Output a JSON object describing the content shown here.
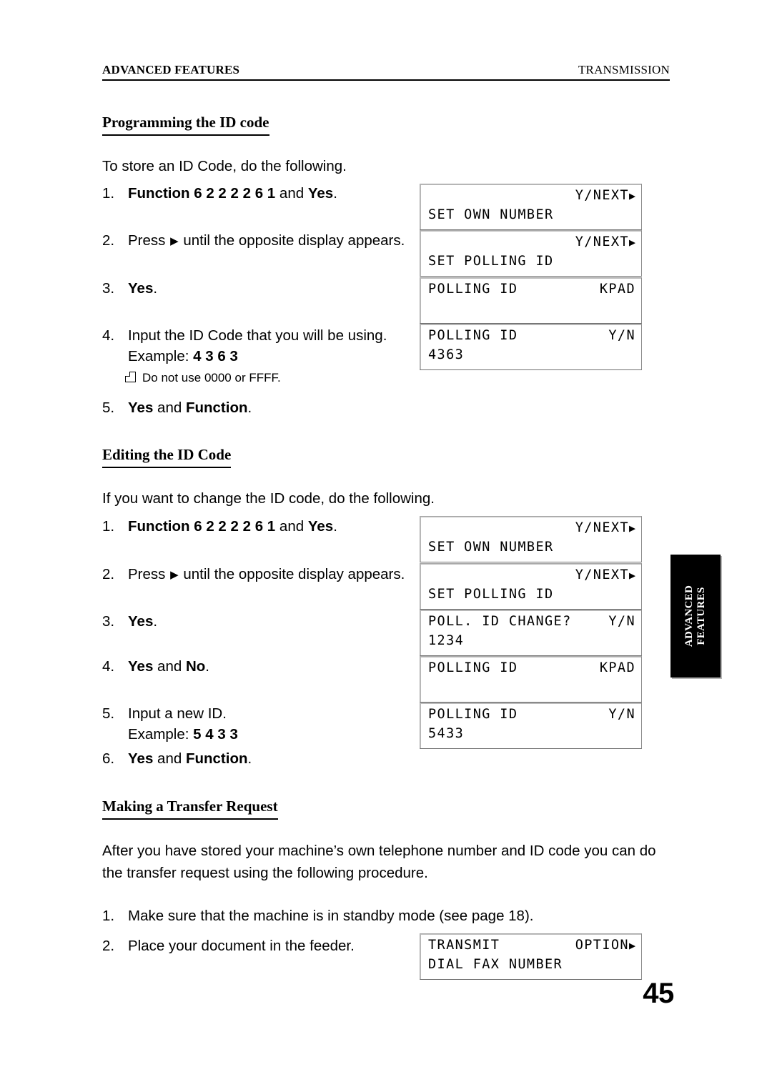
{
  "header": {
    "left": "ADVANCED FEATURES",
    "right": "TRANSMISSION"
  },
  "sections": {
    "programming": {
      "heading": "Programming the ID code",
      "intro": "To store an ID Code, do the following.",
      "steps": [
        {
          "num": "1.",
          "pre": "",
          "bold1": "Function 6 2 2 2 2 6 1",
          "mid": " and ",
          "bold2": "Yes",
          "post": "."
        },
        {
          "num": "2.",
          "pre": "Press ",
          "arrow": "▶",
          "post": " until the opposite display appears."
        },
        {
          "num": "3.",
          "bold1": "Yes",
          "post": "."
        },
        {
          "num": "4.",
          "line1": "Input the ID Code that you will be using.",
          "line2_pre": "Example: ",
          "line2_bold": "4 3 6 3"
        },
        {
          "num": "5.",
          "bold1": "Yes",
          "mid": " and ",
          "bold2": "Function",
          "post": "."
        }
      ],
      "note": "Do not use 0000 or FFFF.",
      "displays": [
        {
          "top_right": "Y/NEXT",
          "arrow": "▶",
          "bottom_left": "SET OWN NUMBER"
        },
        {
          "top_right": "Y/NEXT",
          "arrow": "▶",
          "bottom_left": "SET POLLING ID"
        },
        {
          "top_left": "POLLING ID",
          "top_right_plain": "KPAD",
          "bottom_left": ""
        },
        {
          "top_left": "POLLING ID",
          "top_right_plain": "Y/N",
          "bottom_left": "4363"
        }
      ]
    },
    "editing": {
      "heading": "Editing the ID Code",
      "intro": "If you want to change the ID code, do the following.",
      "steps": [
        {
          "num": "1.",
          "bold1": "Function 6 2 2 2 2 6 1",
          "mid": " and ",
          "bold2": "Yes",
          "post": "."
        },
        {
          "num": "2.",
          "pre": "Press ",
          "arrow": "▶",
          "post": " until the opposite display appears."
        },
        {
          "num": "3.",
          "bold1": "Yes",
          "post": "."
        },
        {
          "num": "4.",
          "bold1": "Yes",
          "mid": " and ",
          "bold2": "No",
          "post": "."
        },
        {
          "num": "5.",
          "line1": "Input a new ID.",
          "line2_pre": "Example: ",
          "line2_bold": "5 4 3 3"
        },
        {
          "num": "6.",
          "bold1": "Yes",
          "mid": " and ",
          "bold2": "Function",
          "post": "."
        }
      ],
      "displays": [
        {
          "top_right": "Y/NEXT",
          "arrow": "▶",
          "bottom_left": "SET OWN NUMBER"
        },
        {
          "top_right": "Y/NEXT",
          "arrow": "▶",
          "bottom_left": "SET POLLING ID"
        },
        {
          "top_left": "POLL. ID CHANGE?",
          "top_right_plain": "Y/N",
          "bottom_left": "1234"
        },
        {
          "top_left": "POLLING ID",
          "top_right_plain": "KPAD",
          "bottom_left": ""
        },
        {
          "top_left": "POLLING ID",
          "top_right_plain": "Y/N",
          "bottom_left": "5433"
        }
      ]
    },
    "transfer": {
      "heading": "Making a Transfer Request",
      "intro": "After you have stored your machine’s own telephone number and ID code you can do the transfer request using the following procedure.",
      "steps": [
        {
          "num": "1.",
          "text": "Make sure that the machine is in standby mode (see page 18)."
        },
        {
          "num": "2.",
          "text": "Place your document in the feeder."
        }
      ],
      "displays": [
        {
          "top_left": "TRANSMIT",
          "top_right_plain": "OPTION",
          "arrow": "▶",
          "bottom_left": "DIAL FAX NUMBER"
        }
      ]
    }
  },
  "thumb_tab": {
    "line1": "ADVANCED",
    "line2": "FEATURES"
  },
  "folio": "45"
}
